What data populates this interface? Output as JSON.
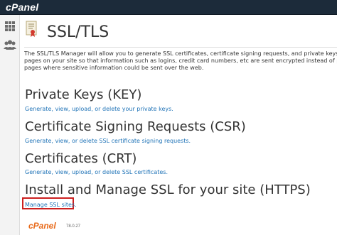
{
  "brand": {
    "logo_text": "cPanel"
  },
  "sidebar": {
    "items": [
      {
        "icon": "grid-icon"
      },
      {
        "icon": "users-icon"
      }
    ]
  },
  "page": {
    "title": "SSL/TLS",
    "icon": "certificate-icon",
    "intro_lines": [
      "The SSL/TLS Manager will allow you to generate SSL certificates, certificate signing requests, and private keys. These are all",
      "pages on your site so that information such as logins, credit card numbers, etc are sent encrypted instead of plain text. It is",
      "pages where sensitive information could be sent over the web."
    ]
  },
  "sections": [
    {
      "heading": "Private Keys (KEY)",
      "link": "Generate, view, upload, or delete your private keys."
    },
    {
      "heading": "Certificate Signing Requests (CSR)",
      "link": "Generate, view, or delete SSL certificate signing requests."
    },
    {
      "heading": "Certificates (CRT)",
      "link": "Generate, view, upload, or delete SSL certificates."
    },
    {
      "heading": "Install and Manage SSL for your site (HTTPS)",
      "link": "Manage SSL sites."
    }
  ],
  "footer": {
    "logo_text": "cPanel",
    "version": "78.0.27"
  },
  "colors": {
    "topbar": "#1c2b3a",
    "link": "#1f73b7",
    "highlight": "#cc1f1f",
    "footer_logo": "#e86a1a"
  }
}
